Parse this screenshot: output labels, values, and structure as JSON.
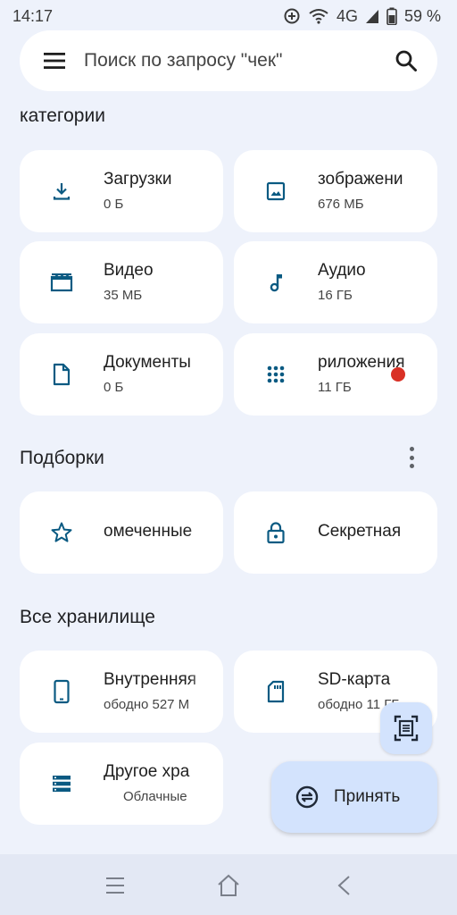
{
  "status": {
    "time": "14:17",
    "network": "4G",
    "battery": "59 %"
  },
  "search": {
    "placeholder": "Поиск по запросу \"чек\""
  },
  "categories": {
    "title": "категории",
    "items": [
      {
        "label": "Загрузки",
        "sub": "0 Б",
        "icon": "download-icon"
      },
      {
        "label": "зображени",
        "sub": "676 МБ",
        "icon": "image-icon"
      },
      {
        "label": "Видео",
        "sub": "35 МБ",
        "icon": "video-icon"
      },
      {
        "label": "Аудио",
        "sub": "16 ГБ",
        "icon": "music-note-icon"
      },
      {
        "label": "Документы",
        "sub": "0 Б",
        "icon": "document-icon"
      },
      {
        "label": "риложения",
        "sub": "11 ГБ",
        "icon": "apps-grid-icon"
      }
    ]
  },
  "collections": {
    "title": "Подборки",
    "items": [
      {
        "label": "омеченные",
        "icon": "star-icon"
      },
      {
        "label": "Секретная",
        "icon": "lock-icon"
      }
    ]
  },
  "storage": {
    "title": "Все хранилище",
    "items": [
      {
        "label": "Внутренняя",
        "sub": "ободно 527 М",
        "icon": "phone-icon"
      },
      {
        "label": "SD-карта",
        "sub": "ободно 11 ГБ",
        "icon": "sd-card-icon"
      },
      {
        "label": "Другое хра",
        "sub": "Облачные",
        "icon": "storage-list-icon"
      }
    ]
  },
  "fab": {
    "label": "Принять"
  },
  "colors": {
    "accent": "#0b57d0",
    "icon": "#0a5a82",
    "fab": "#d3e3fd",
    "background": "#eef2fb"
  }
}
